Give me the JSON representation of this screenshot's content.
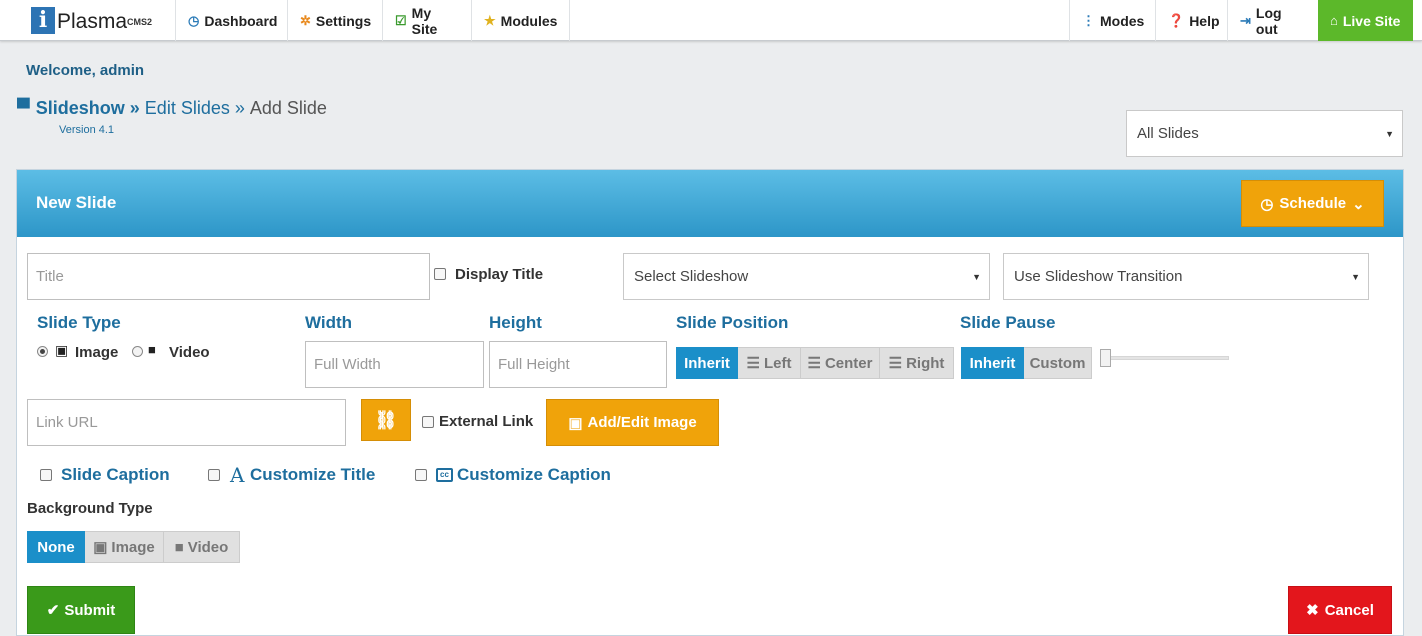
{
  "nav": {
    "logo_main": "Plasma",
    "logo_sup": "CMS2",
    "logo_letter": "i",
    "dashboard": "Dashboard",
    "settings": "Settings",
    "mysite": "My Site",
    "modules": "Modules",
    "modes": "Modes",
    "help": "Help",
    "logout": "Log out",
    "livesite": "Live Site"
  },
  "header": {
    "welcome": "Welcome, admin",
    "module": "Slideshow",
    "sep1": "»",
    "crumb_edit": "Edit Slides",
    "sep2": "»",
    "crumb_current": "Add Slide",
    "version": "Version 4.1",
    "filter_select": "All Slides"
  },
  "panel": {
    "title": "New Slide",
    "schedule_label": "Schedule"
  },
  "form": {
    "title_placeholder": "Title",
    "display_title": "Display Title",
    "slideshow_select": "Select Slideshow",
    "transition_select": "Use Slideshow Transition",
    "slide_type_heading": "Slide Type",
    "type_image": "Image",
    "type_video": "Video",
    "width_heading": "Width",
    "width_placeholder": "Full Width",
    "height_heading": "Height",
    "height_placeholder": "Full Height",
    "position_heading": "Slide Position",
    "position_options": [
      "Inherit",
      "Left",
      "Center",
      "Right"
    ],
    "pause_heading": "Slide Pause",
    "pause_options": [
      "Inherit",
      "Custom"
    ],
    "link_placeholder": "Link URL",
    "external_link": "External Link",
    "add_image": "Add/Edit Image",
    "slide_caption": "Slide Caption",
    "customize_title": "Customize Title",
    "customize_caption": "Customize Caption",
    "bg_heading": "Background Type",
    "bg_options": [
      "None",
      "Image",
      "Video"
    ],
    "submit": "Submit",
    "cancel": "Cancel"
  },
  "colors": {
    "accent": "#1b8fc9",
    "orange": "#f0a30a",
    "green": "#3c9a1a",
    "red": "#e0141a"
  }
}
